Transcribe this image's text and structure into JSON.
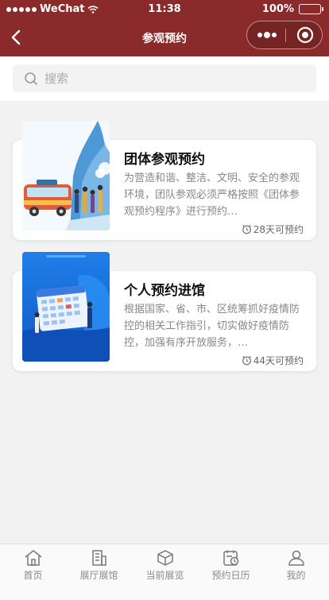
{
  "status": {
    "carrier": "WeChat",
    "time": "11:38",
    "battery": "100%"
  },
  "nav": {
    "title": "参观预约",
    "back_icon": "chevron-left-icon",
    "more_icon": "more-dots-icon",
    "close_icon": "target-icon",
    "header_color": "#8b2a2a"
  },
  "search": {
    "placeholder": "搜索",
    "icon": "search-icon"
  },
  "cards": [
    {
      "title": "团体参观预约",
      "description": "为营造和谐、整洁、文明、安全的参观环境，团队参观必须严格按照《团体参观预约程序》进行预约…",
      "badge": "28天可预约"
    },
    {
      "title": "个人预约进馆",
      "description": "根据国家、省、市、区统筹抓好疫情防控的相关工作指引，切实做好疫情防控，加强有序开放服务，…",
      "badge": "44天可预约"
    }
  ],
  "tabbar": {
    "items": [
      {
        "label": "首页",
        "icon": "home-icon"
      },
      {
        "label": "展厅展馆",
        "icon": "building-icon"
      },
      {
        "label": "当前展览",
        "icon": "cube-icon"
      },
      {
        "label": "预约日历",
        "icon": "calendar-clock-icon"
      },
      {
        "label": "我的",
        "icon": "user-icon"
      }
    ]
  }
}
